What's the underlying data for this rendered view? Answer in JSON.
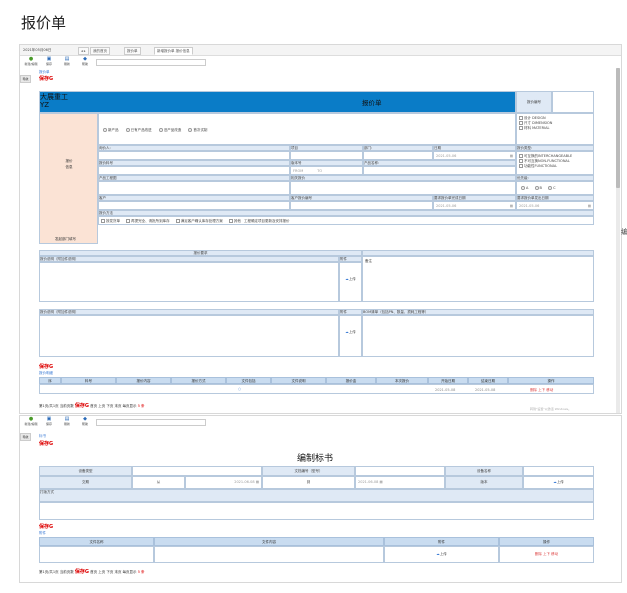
{
  "page_title": "报价单",
  "top_frame": {
    "date": "2021年05月06日",
    "tabs": [
      "我的首页",
      "报价单",
      "新增报价单 报价信息"
    ],
    "toolbar": [
      "新建/编辑",
      "保存",
      "刷新",
      "帮助"
    ],
    "sidetab": "导航",
    "breadcrumb": "报价单",
    "save_label": "保存G",
    "company_name": "大展重工",
    "company_sub": "YZ",
    "doc_title": "报价单",
    "quote_no_label": "报价编号",
    "product_type_radios": [
      "新产品",
      "已有产品改进",
      "旧产品改造",
      "首次试制"
    ],
    "left_section_label": "报价信息",
    "dept_note": "发起部门填写",
    "fields": {
      "inquirer": "询价人:",
      "project": "项目",
      "dept": "部门:",
      "date": "日期",
      "date_val": "2021-05-06",
      "quote_type": "报价类型:",
      "part_no": "报价料号",
      "version": "版本号",
      "product_name": "产品名称:",
      "from": "FROM",
      "to": "TO",
      "product_drawing": "产品工程图",
      "related_quote": "相关报价",
      "priority": "优先级:",
      "customer": "客户",
      "customer_quote_no": "客户报价编号",
      "req_complete_date": "要求报价单完成日期",
      "req_submit_date": "要求报价单发出日期",
      "req_date_val1": "2021-05-06",
      "req_date_val2": "2021-05-06",
      "quote_method": "报价方法"
    },
    "quote_type_checks": [
      "设计 DESIGN",
      "尺寸 DIMENSION",
      "材料 MATERIAL"
    ],
    "quote_type_checks2": [
      "可互换的INTERCHANGEABLE",
      "不可互换NON-FUNCTIONAL",
      "功能性FUNCTIONAL"
    ],
    "priority_opts": [
      "A",
      "B",
      "C"
    ],
    "method_checks": [
      "按发货单",
      "再提完全、请批所到库存",
      "满足客户确认库存处理方案",
      "其他",
      "工程确定项目更新及安排报价"
    ],
    "quote_req_header": "报价要求",
    "quote_desc_label": "报价说明（附加件说明）",
    "attachment_label": "附件",
    "remark_label": "备注",
    "quote_desc_label2": "报价说明（附加件说明）",
    "attachment_label2": "附件",
    "bom_label": "BOM清单（包括PN、数量、损耗工程等）",
    "upload_label": "上传",
    "save_label2": "保存G",
    "table_link": "报价明细",
    "table_headers": [
      "序",
      "料号",
      "报价内容",
      "报价方式",
      "文件包括",
      "文件说明",
      "报价金",
      "本次报价",
      "开始日期",
      "结束日期",
      "操作"
    ],
    "table_row": {
      "start": "2021-05-08",
      "end": "2021-05-08",
      "op": "删除 上下 移动"
    },
    "footer_note": "第1页/共1页 当前页数",
    "footer_save": "保存G",
    "footer_links": "首页 上页 下页 末页 每页显示",
    "footer_red": "5 条",
    "win_activate": "转到\"设置\"以激活 Windows。",
    "right_edge": "编"
  },
  "bottom_frame": {
    "toolbar": [
      "新建/编辑",
      "保存",
      "刷新",
      "帮助"
    ],
    "sidetab": "导航",
    "breadcrumb": "标书",
    "save_label": "保存G",
    "doc_title": "编制标书",
    "labels": [
      "设备类型",
      "文档编号（型号）",
      "设备名称",
      "交期",
      "从",
      "到",
      "版本"
    ],
    "date_from": "2021-06-08",
    "date_to": "2021-06-08",
    "upload_label": "上传",
    "method_label": "打版方式",
    "save_label2": "保存G",
    "table_link": "附件",
    "table_headers": [
      "文件名称",
      "文件内容",
      "附件",
      "操作"
    ],
    "table_op": "删除 上下 移动",
    "footer_note": "第1页/共1页 当前页数",
    "footer_save": "保存G",
    "footer_links": "首页 上页 下页 末页 每页显示",
    "footer_red": "5 条"
  }
}
